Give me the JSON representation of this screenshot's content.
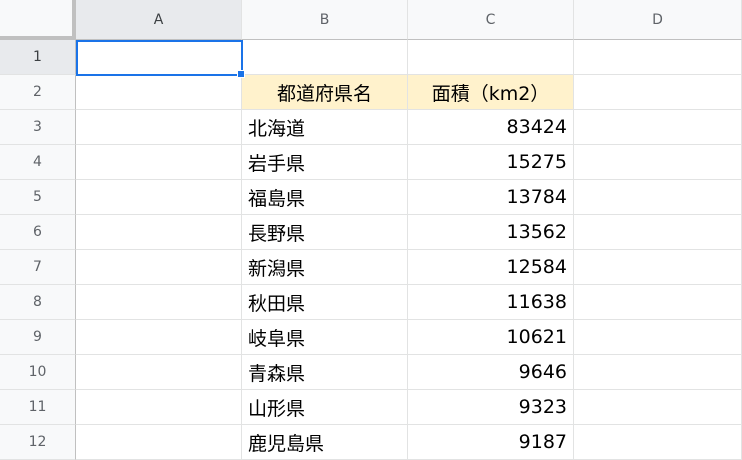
{
  "columns": [
    "A",
    "B",
    "C",
    "D"
  ],
  "selected_cell": "A1",
  "colors": {
    "selection": "#1a73e8",
    "header_fill": "#fff2cc"
  },
  "table": {
    "header": [
      "都道府県名",
      "面積（km2）"
    ],
    "rows": [
      [
        "北海道",
        "83424"
      ],
      [
        "岩手県",
        "15275"
      ],
      [
        "福島県",
        "13784"
      ],
      [
        "長野県",
        "13562"
      ],
      [
        "新潟県",
        "12584"
      ],
      [
        "秋田県",
        "11638"
      ],
      [
        "岐阜県",
        "10621"
      ],
      [
        "青森県",
        "9646"
      ],
      [
        "山形県",
        "9323"
      ],
      [
        "鹿児島県",
        "9187"
      ]
    ]
  },
  "row_numbers": [
    "1",
    "2",
    "3",
    "4",
    "5",
    "6",
    "7",
    "8",
    "9",
    "10",
    "11",
    "12"
  ]
}
